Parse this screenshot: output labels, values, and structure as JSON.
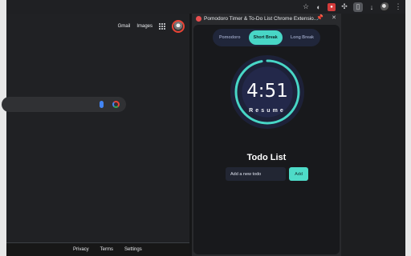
{
  "browser": {
    "toolbar_icons": [
      "star-icon",
      "extension-icon",
      "red-extension-icon",
      "puzzle-icon",
      "sidepanel-icon",
      "download-icon",
      "avatar",
      "menu-icon"
    ],
    "colors": {
      "toolbar": "#1f2023",
      "accent_red": "#d33b3b"
    }
  },
  "google": {
    "top_links": [
      "Gmail",
      "Images"
    ],
    "footer_links": [
      "Privacy",
      "Terms",
      "Settings"
    ]
  },
  "extension": {
    "title": "Pomodoro Timer & To-Do List Chrome Extensio...",
    "tabs": [
      {
        "label": "Pomodoro",
        "active": false
      },
      {
        "label": "Short Break",
        "active": true
      },
      {
        "label": "Long Break",
        "active": false
      }
    ],
    "timer": {
      "time": "4:51",
      "action": "Resume",
      "remaining_fraction": 0.97,
      "accent": "#48d6c6"
    },
    "todo": {
      "title": "Todo List",
      "placeholder": "Add a new todo",
      "add_label": "Add"
    }
  }
}
